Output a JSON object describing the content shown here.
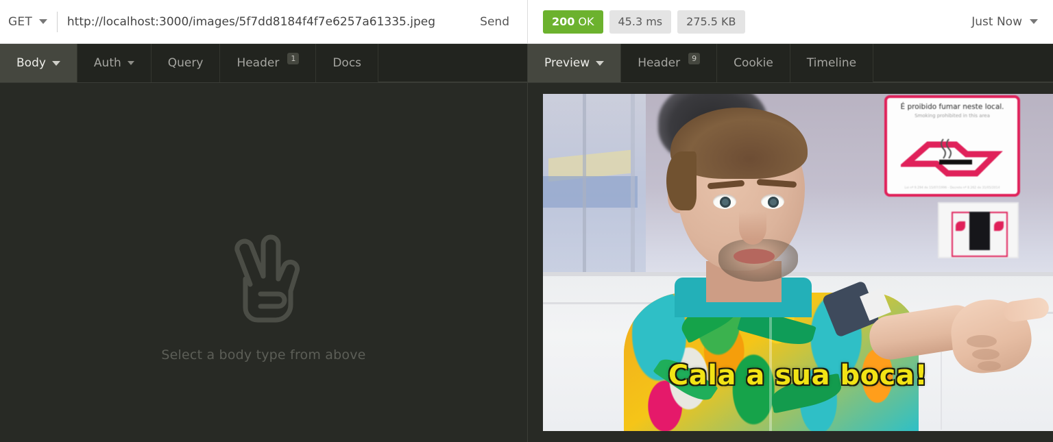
{
  "request_bar": {
    "method": "GET",
    "method_caret_icon": "chevron-down-icon",
    "url": "http://localhost:3000/images/5f7dd8184f4f7e6257a61335.jpeg",
    "send_label": "Send"
  },
  "response_bar": {
    "status_code": "200",
    "status_text": "OK",
    "status_color": "#6cb22e",
    "time": "45.3 ms",
    "size": "275.5 KB",
    "timestamp_label": "Just Now",
    "timestamp_caret_icon": "chevron-down-icon"
  },
  "request_tabs": [
    {
      "label": "Body",
      "caret": true,
      "active": true,
      "badge": null
    },
    {
      "label": "Auth",
      "caret": true,
      "active": false,
      "badge": null
    },
    {
      "label": "Query",
      "caret": false,
      "active": false,
      "badge": null
    },
    {
      "label": "Header",
      "caret": false,
      "active": false,
      "badge": "1"
    },
    {
      "label": "Docs",
      "caret": false,
      "active": false,
      "badge": null
    }
  ],
  "response_tabs": [
    {
      "label": "Preview",
      "caret": true,
      "active": true,
      "badge": null
    },
    {
      "label": "Header",
      "caret": false,
      "active": false,
      "badge": "9"
    },
    {
      "label": "Cookie",
      "caret": false,
      "active": false,
      "badge": null
    },
    {
      "label": "Timeline",
      "caret": false,
      "active": false,
      "badge": null
    }
  ],
  "request_body_empty": {
    "icon": "peace-hand-icon",
    "message": "Select a body type from above"
  },
  "preview_image": {
    "alt": "Man in colorful tropical shirt pointing, meme still",
    "caption": "Cala a sua boca!",
    "sign_title": "É proibido fumar neste local.",
    "sign_subtitle": "Smoking prohibited in this area",
    "sign_footnote": "Lei nº 9.294 de 15/07/1996 - Decreto nº 8.262 de 31/05/2014",
    "sign_glyph": "no-smoking-icon"
  },
  "theme": {
    "dark_bg": "#282a25",
    "tab_bg": "#22241f",
    "tab_active_bg": "#45473f",
    "light_bg": "#ffffff",
    "accent_green": "#6cb22e"
  }
}
